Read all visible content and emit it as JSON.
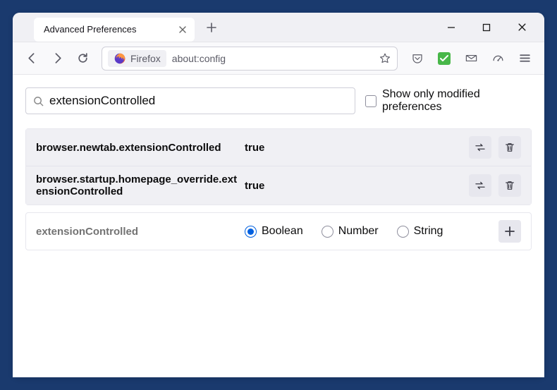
{
  "window": {
    "tab_title": "Advanced Preferences"
  },
  "urlbar": {
    "identity_label": "Firefox",
    "url": "about:config"
  },
  "search": {
    "value": "extensionControlled",
    "filter_label": "Show only modified preferences"
  },
  "prefs": [
    {
      "name": "browser.newtab.extensionControlled",
      "value": "true"
    },
    {
      "name": "browser.startup.homepage_override.extensionControlled",
      "value": "true"
    }
  ],
  "new_pref": {
    "name": "extensionControlled",
    "types": [
      "Boolean",
      "Number",
      "String"
    ],
    "selected": "Boolean"
  }
}
